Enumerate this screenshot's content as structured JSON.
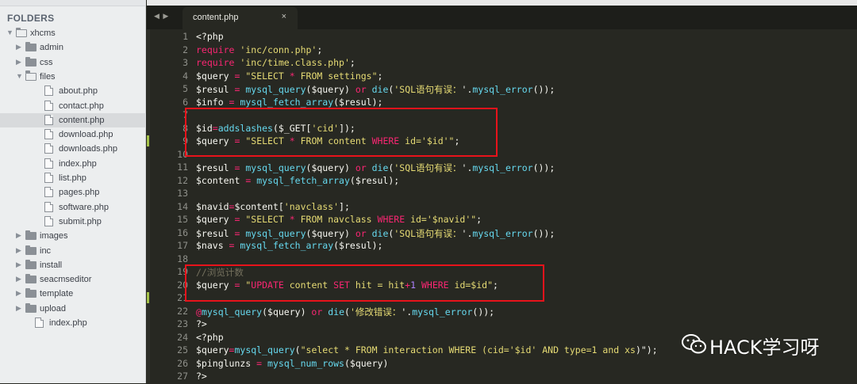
{
  "sidebar": {
    "header": "FOLDERS",
    "tree": [
      {
        "label": "xhcms",
        "type": "folder-open",
        "depth": 0,
        "arrow": "▼"
      },
      {
        "label": "admin",
        "type": "folder",
        "depth": 1,
        "arrow": "▶"
      },
      {
        "label": "css",
        "type": "folder",
        "depth": 1,
        "arrow": "▶"
      },
      {
        "label": "files",
        "type": "folder-open",
        "depth": 1,
        "arrow": "▼"
      },
      {
        "label": "about.php",
        "type": "file",
        "depth": 2
      },
      {
        "label": "contact.php",
        "type": "file",
        "depth": 2
      },
      {
        "label": "content.php",
        "type": "file",
        "depth": 2,
        "selected": true
      },
      {
        "label": "download.php",
        "type": "file",
        "depth": 2
      },
      {
        "label": "downloads.php",
        "type": "file",
        "depth": 2
      },
      {
        "label": "index.php",
        "type": "file",
        "depth": 2
      },
      {
        "label": "list.php",
        "type": "file",
        "depth": 2
      },
      {
        "label": "pages.php",
        "type": "file",
        "depth": 2
      },
      {
        "label": "software.php",
        "type": "file",
        "depth": 2
      },
      {
        "label": "submit.php",
        "type": "file",
        "depth": 2
      },
      {
        "label": "images",
        "type": "folder",
        "depth": 1,
        "arrow": "▶"
      },
      {
        "label": "inc",
        "type": "folder",
        "depth": 1,
        "arrow": "▶"
      },
      {
        "label": "install",
        "type": "folder",
        "depth": 1,
        "arrow": "▶"
      },
      {
        "label": "seacmseditor",
        "type": "folder",
        "depth": 1,
        "arrow": "▶"
      },
      {
        "label": "template",
        "type": "folder",
        "depth": 1,
        "arrow": "▶"
      },
      {
        "label": "upload",
        "type": "folder",
        "depth": 1,
        "arrow": "▶"
      },
      {
        "label": "index.php",
        "type": "file",
        "depth": 1
      }
    ]
  },
  "tabs": {
    "nav_arrows": "◀ ▶",
    "active_title": "content.php",
    "close_glyph": "×"
  },
  "editor": {
    "modified_lines": [
      9,
      21
    ],
    "lines": [
      [
        [
          "t",
          "<?php"
        ]
      ],
      [
        [
          "kw",
          "require"
        ],
        [
          "t",
          " "
        ],
        [
          "str",
          "'inc/conn.php'"
        ],
        [
          "t",
          ";"
        ]
      ],
      [
        [
          "kw",
          "require"
        ],
        [
          "t",
          " "
        ],
        [
          "str",
          "'inc/time.class.php'"
        ],
        [
          "t",
          ";"
        ]
      ],
      [
        [
          "t",
          "$query "
        ],
        [
          "kw",
          "="
        ],
        [
          "t",
          " "
        ],
        [
          "str",
          "\"SELECT "
        ],
        [
          "kw",
          "*"
        ],
        [
          "str",
          " FROM settings\""
        ],
        [
          "t",
          ";"
        ]
      ],
      [
        [
          "t",
          "$resul "
        ],
        [
          "kw",
          "="
        ],
        [
          "t",
          " "
        ],
        [
          "fn",
          "mysql_query"
        ],
        [
          "t",
          "($query) "
        ],
        [
          "kw",
          "or"
        ],
        [
          "t",
          " "
        ],
        [
          "fn",
          "die"
        ],
        [
          "t",
          "("
        ],
        [
          "str",
          "'SQL语句有误："
        ],
        [
          "t",
          "'."
        ],
        [
          "fn",
          "mysql_error"
        ],
        [
          "t",
          "());"
        ]
      ],
      [
        [
          "t",
          "$info "
        ],
        [
          "kw",
          "="
        ],
        [
          "t",
          " "
        ],
        [
          "fn",
          "mysql_fetch_array"
        ],
        [
          "t",
          "($resul);"
        ]
      ],
      [],
      [
        [
          "t",
          "$id"
        ],
        [
          "kw",
          "="
        ],
        [
          "fn",
          "addslashes"
        ],
        [
          "t",
          "($_GET["
        ],
        [
          "str",
          "'cid'"
        ],
        [
          "t",
          "]);"
        ]
      ],
      [
        [
          "t",
          "$query "
        ],
        [
          "kw",
          "="
        ],
        [
          "t",
          " "
        ],
        [
          "str",
          "\"SELECT "
        ],
        [
          "kw",
          "*"
        ],
        [
          "str",
          " FROM content "
        ],
        [
          "kw",
          "WHERE"
        ],
        [
          "str",
          " id='$id'\""
        ],
        [
          "t",
          ";"
        ]
      ],
      [],
      [
        [
          "t",
          "$resul "
        ],
        [
          "kw",
          "="
        ],
        [
          "t",
          " "
        ],
        [
          "fn",
          "mysql_query"
        ],
        [
          "t",
          "($query) "
        ],
        [
          "kw",
          "or"
        ],
        [
          "t",
          " "
        ],
        [
          "fn",
          "die"
        ],
        [
          "t",
          "("
        ],
        [
          "str",
          "'SQL语句有误："
        ],
        [
          "t",
          "'."
        ],
        [
          "fn",
          "mysql_error"
        ],
        [
          "t",
          "());"
        ]
      ],
      [
        [
          "t",
          "$content "
        ],
        [
          "kw",
          "="
        ],
        [
          "t",
          " "
        ],
        [
          "fn",
          "mysql_fetch_array"
        ],
        [
          "t",
          "($resul);"
        ]
      ],
      [],
      [
        [
          "t",
          "$navid"
        ],
        [
          "kw",
          "="
        ],
        [
          "t",
          "$content["
        ],
        [
          "str",
          "'navclass'"
        ],
        [
          "t",
          "];"
        ]
      ],
      [
        [
          "t",
          "$query "
        ],
        [
          "kw",
          "="
        ],
        [
          "t",
          " "
        ],
        [
          "str",
          "\"SELECT "
        ],
        [
          "kw",
          "*"
        ],
        [
          "str",
          " FROM navclass "
        ],
        [
          "kw",
          "WHERE"
        ],
        [
          "str",
          " id='$navid'\""
        ],
        [
          "t",
          ";"
        ]
      ],
      [
        [
          "t",
          "$resul "
        ],
        [
          "kw",
          "="
        ],
        [
          "t",
          " "
        ],
        [
          "fn",
          "mysql_query"
        ],
        [
          "t",
          "($query) "
        ],
        [
          "kw",
          "or"
        ],
        [
          "t",
          " "
        ],
        [
          "fn",
          "die"
        ],
        [
          "t",
          "("
        ],
        [
          "str",
          "'SQL语句有误："
        ],
        [
          "t",
          "'."
        ],
        [
          "fn",
          "mysql_error"
        ],
        [
          "t",
          "());"
        ]
      ],
      [
        [
          "t",
          "$navs "
        ],
        [
          "kw",
          "="
        ],
        [
          "t",
          " "
        ],
        [
          "fn",
          "mysql_fetch_array"
        ],
        [
          "t",
          "($resul);"
        ]
      ],
      [],
      [
        [
          "cmt",
          "//浏览计数"
        ]
      ],
      [
        [
          "t",
          "$query "
        ],
        [
          "kw",
          "="
        ],
        [
          "t",
          " "
        ],
        [
          "str",
          "\""
        ],
        [
          "kw",
          "UPDATE"
        ],
        [
          "str",
          " content "
        ],
        [
          "kw",
          "SET"
        ],
        [
          "str",
          " hit = hit"
        ],
        [
          "kw",
          "+"
        ],
        [
          "num",
          "1"
        ],
        [
          "str",
          " "
        ],
        [
          "kw",
          "WHERE"
        ],
        [
          "str",
          " id=$id\""
        ],
        [
          "t",
          ";"
        ]
      ],
      [],
      [
        [
          "kw",
          "@"
        ],
        [
          "fn",
          "mysql_query"
        ],
        [
          "t",
          "($query) "
        ],
        [
          "kw",
          "or"
        ],
        [
          "t",
          " "
        ],
        [
          "fn",
          "die"
        ],
        [
          "t",
          "("
        ],
        [
          "str",
          "'修改错误："
        ],
        [
          "t",
          "'."
        ],
        [
          "fn",
          "mysql_error"
        ],
        [
          "t",
          "());"
        ]
      ],
      [
        [
          "t",
          "?>"
        ]
      ],
      [
        [
          "t",
          "<?php"
        ]
      ],
      [
        [
          "t",
          "$query"
        ],
        [
          "kw",
          "="
        ],
        [
          "fn",
          "mysql_query"
        ],
        [
          "t",
          "("
        ],
        [
          "str",
          "\"select * FROM interaction WHERE (cid='$id' AND type=1 and xs"
        ],
        [
          "t",
          ")\");"
        ]
      ],
      [
        [
          "t",
          "$pinglunzs "
        ],
        [
          "kw",
          "="
        ],
        [
          "t",
          " "
        ],
        [
          "fn",
          "mysql_num_rows"
        ],
        [
          "t",
          "($query)"
        ]
      ],
      [
        [
          "t",
          "?>"
        ]
      ]
    ]
  },
  "watermark": {
    "icon": "wechat-icon",
    "text": "HACK学习呀"
  },
  "colors": {
    "editor_bg": "#272822",
    "highlight_box": "#e8131b",
    "keyword": "#f92672",
    "string": "#e6db74",
    "function": "#66d9ef"
  }
}
